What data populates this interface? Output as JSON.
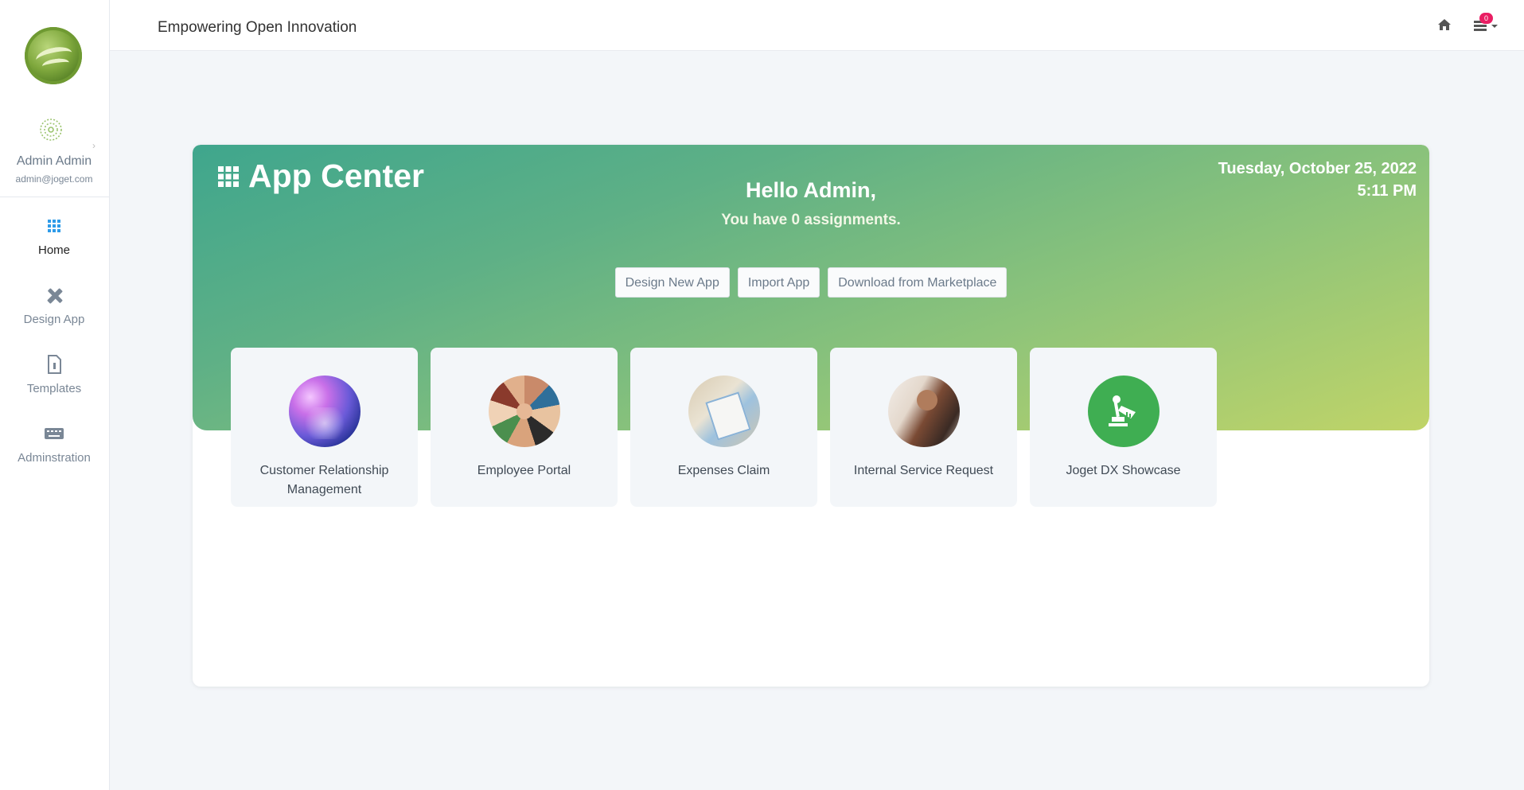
{
  "topbar": {
    "title": "Empowering Open Innovation",
    "home_icon": "home-icon",
    "inbox_icon": "inbox-icon",
    "inbox_count": "0",
    "badge_color": "#e91e63"
  },
  "sidebar": {
    "user": {
      "name": "Admin Admin",
      "email": "admin@joget.com"
    },
    "items": [
      {
        "label": "Home",
        "icon": "grid-icon",
        "active": true
      },
      {
        "label": "Design App",
        "icon": "design-tools-icon",
        "active": false
      },
      {
        "label": "Templates",
        "icon": "file-icon",
        "active": false
      },
      {
        "label": "Adminstration",
        "icon": "keyboard-icon",
        "active": false
      }
    ]
  },
  "hero": {
    "title": "App Center",
    "date": "Tuesday, October 25, 2022",
    "time": "5:11 PM",
    "greeting": "Hello Admin,",
    "assignments": "You have 0 assignments.",
    "gradient_start": "#3fa68d",
    "gradient_end": "#c0d468"
  },
  "actions": {
    "design_new_app": "Design New App",
    "import_app": "Import App",
    "download_marketplace": "Download from Marketplace"
  },
  "apps": [
    {
      "name": "Customer Relationship Management"
    },
    {
      "name": "Employee Portal"
    },
    {
      "name": "Expenses Claim"
    },
    {
      "name": "Internal Service Request"
    },
    {
      "name": "Joget DX Showcase"
    }
  ]
}
